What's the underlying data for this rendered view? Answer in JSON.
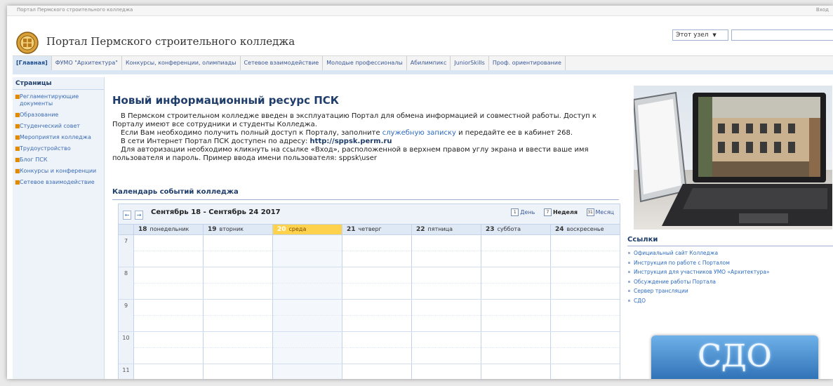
{
  "topbar": {
    "breadcrumb": "Портал Пермского строительного колледжа",
    "right": "Вход"
  },
  "header": {
    "title": "Портал Пермского строительного колледжа",
    "search_scope": "Этот узел",
    "search_arrow": "▼"
  },
  "nav": {
    "tabs": [
      {
        "label": "[Главная]",
        "active": true
      },
      {
        "label": "ФУМО \"Архитектура\""
      },
      {
        "label": "Конкурсы, конференции, олимпиады"
      },
      {
        "label": "Сетевое взаимодействие"
      },
      {
        "label": "Молодые профессионалы"
      },
      {
        "label": "Абилимпикс"
      },
      {
        "label": "JuniorSkills"
      },
      {
        "label": "Проф. ориентирование"
      }
    ]
  },
  "sidebar": {
    "heading": "Страницы",
    "items": [
      {
        "label": "Регламентирующие документы"
      },
      {
        "label": "Образование"
      },
      {
        "label": "Студенческий совет"
      },
      {
        "label": "Мероприятия колледжа"
      },
      {
        "label": "Трудоустройство"
      },
      {
        "label": "Блог ПСК"
      },
      {
        "label": "Конкурсы и конференции"
      },
      {
        "label": "Сетевое взаимодействие"
      }
    ]
  },
  "article": {
    "title": "Новый информационный ресурс ПСК",
    "p1": "В Пермском строительном колледже введен в эксплуатацию Портал для обмена информацией и совместной работы. Доступ к Порталу имеют все сотрудники и студенты Колледжа.",
    "p2_before": "Если Вам необходимо получить полный доступ к Порталу, заполните ",
    "p2_link": "служебную записку",
    "p2_after": " и передайте ее в кабинет 268.",
    "p3_before": "В сети Интернет Портал ПСК доступен по адресу: ",
    "p3_url": "http://sppsk.perm.ru",
    "p4": "Для авторизации необходимо кликнуть на ссылке «Вход», расположенной в верхнем правом углу экрана и ввести ваше имя пользователя и пароль. Пример ввода имени пользователя: sppsk\\user"
  },
  "calendar": {
    "title": "Календарь событий колледжа",
    "prev": "←",
    "next": "→",
    "range": "Сентябрь 18 - Сентябрь 24 2017",
    "views": {
      "day": "День",
      "day_icon": "1",
      "week": "Неделя",
      "week_icon": "7",
      "month": "Месяц",
      "month_icon": "31"
    },
    "days": [
      {
        "num": "18",
        "name": "понедельник"
      },
      {
        "num": "19",
        "name": "вторник"
      },
      {
        "num": "20",
        "name": "среда",
        "today": true
      },
      {
        "num": "21",
        "name": "четверг"
      },
      {
        "num": "22",
        "name": "пятница"
      },
      {
        "num": "23",
        "name": "суббота"
      },
      {
        "num": "24",
        "name": "воскресенье"
      }
    ],
    "hours": [
      "7",
      "8",
      "9",
      "10",
      "11"
    ]
  },
  "links": {
    "title": "Ссылки",
    "items": [
      {
        "label": "Официальный сайт Колледжа"
      },
      {
        "label": "Инструкция по работе с Порталом"
      },
      {
        "label": "Инструкция для участников УМО «Архитектура»"
      },
      {
        "label": "Обсуждение работы Портала"
      },
      {
        "label": "Сервер трансляции"
      },
      {
        "label": "СДО"
      }
    ]
  },
  "banner": {
    "label": "СДО"
  },
  "colors": {
    "accent": "#1f3d6a",
    "link": "#2e6bc0",
    "today": "#ffd24d"
  }
}
